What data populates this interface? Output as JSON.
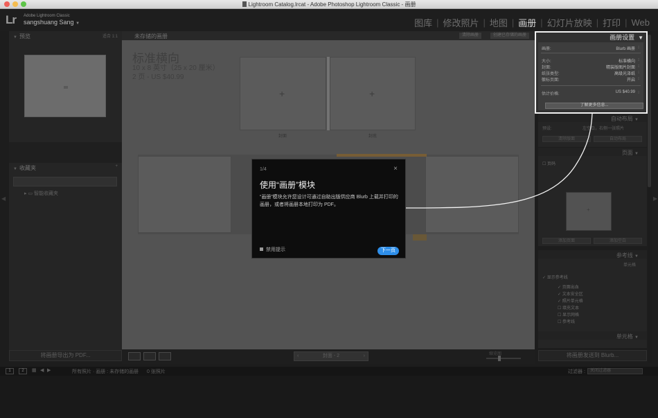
{
  "window": {
    "title": "Lightroom Catalog.lrcat - Adobe Photoshop Lightroom Classic - 画册",
    "traffic_colors": [
      "#ee5f58",
      "#f5bd4f",
      "#5ec449"
    ]
  },
  "identity": {
    "logo": "Lr",
    "app_name": "Adobe Lightroom Classic",
    "user": "sangshuang Sang",
    "user_caret": "▼"
  },
  "modules": [
    {
      "label": "图库",
      "active": false
    },
    {
      "label": "修改照片",
      "active": false
    },
    {
      "label": "地图",
      "active": false
    },
    {
      "label": "画册",
      "active": true
    },
    {
      "label": "幻灯片放映",
      "active": false
    },
    {
      "label": "打印",
      "active": false
    },
    {
      "label": "Web",
      "active": false
    }
  ],
  "left_panel": {
    "preview_header": "预览",
    "preview_right": "适合 1:1",
    "collections_header": "收藏夹",
    "collections_item": "智能收藏夹",
    "export_pdf": "将画册导出为 PDF..."
  },
  "center": {
    "header_title": "未存储的画册",
    "header_btn_1": "清除画册",
    "header_btn_2": "创建已存储的画册",
    "book_title": "标准横向",
    "book_size": "10 x 8 英寸（25 x 20 厘米）",
    "book_pages": "2 页 - US $40.99",
    "cover_label_1": "封面",
    "cover_label_2": "封底",
    "page_nav": "封面 - 2",
    "zoom_label": "缩览图"
  },
  "book_settings": {
    "title": "画册设置",
    "rows": [
      {
        "key": "画册:",
        "value": "Blurb 画册"
      },
      {
        "key": "大小:",
        "value": "标准横向"
      },
      {
        "key": "封面:",
        "value": "精装版图片封面"
      },
      {
        "key": "纸张类型:",
        "value": "高级光泽纸"
      },
      {
        "key": "徽标页面:",
        "value": "开启"
      },
      {
        "key": "估计价格:",
        "value": "US $40.99"
      }
    ],
    "learn_more": "了解更多信息..."
  },
  "right_panel": {
    "auto_layout": "自动布局",
    "auto_layout_row_label": "预设:",
    "auto_layout_row_value": "左空白，右侧一张照片",
    "auto_btn_1": "清除版面",
    "auto_btn_2": "自动布局",
    "page_header": "页面",
    "page_number_label": "页码",
    "page_btn_1": "添加页面",
    "page_btn_2": "添加空白",
    "guides_header": "参考线",
    "guides_right": "单元格",
    "guides_show": "显示参考线",
    "guides_items": [
      "页面出血",
      "文本安全区",
      "照片单元格",
      "填充文本",
      "显示网格",
      "参考线"
    ],
    "cell_header": "单元格",
    "send_to_blurb": "将画册发送到 Blurb..."
  },
  "filmstrip": {
    "btn_1": "1",
    "btn_2": "2",
    "source": "所有照片",
    "book_label": "画册 : 未存储的画册",
    "count": "0 张照片",
    "filter_label": "过滤器 :",
    "filter_value": "关闭过滤器"
  },
  "tip": {
    "counter": "1/4",
    "heading": "使用“画册”模块",
    "body": "“画册”模块允许您设计可通过自助出版供应商 Blurb 上载并打印的画册，或者将画册本地打印为 PDF。",
    "disable": "禁用提示",
    "next": "下一页"
  }
}
